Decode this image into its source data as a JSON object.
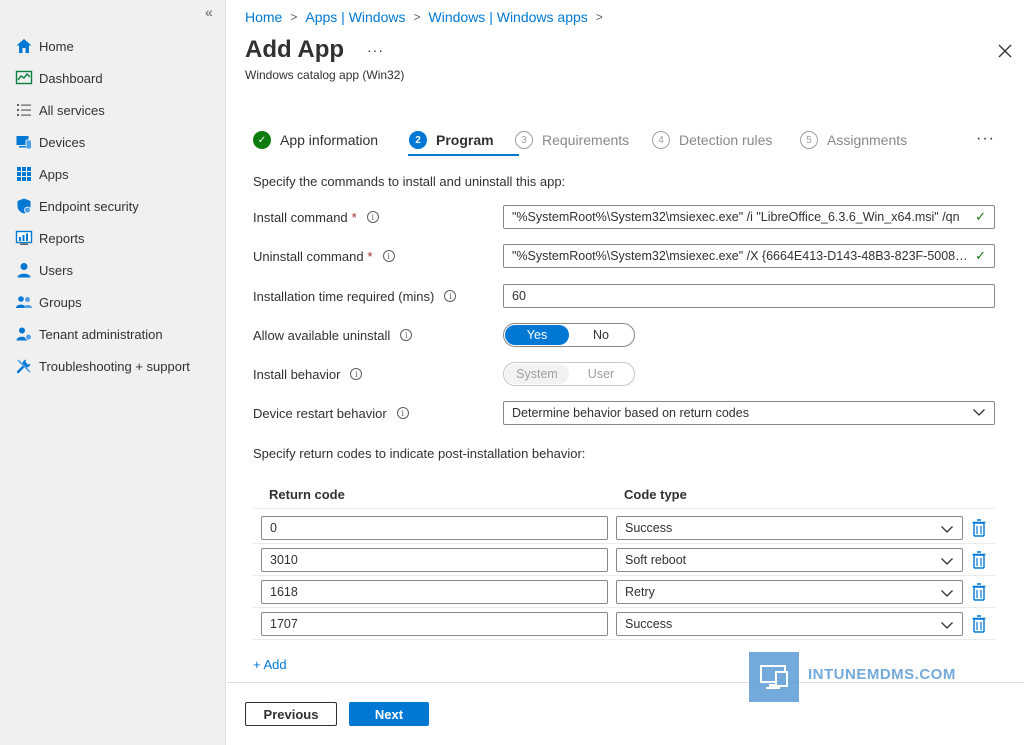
{
  "sidebar": {
    "collapse_icon": "«",
    "items": [
      {
        "label": "Home",
        "icon": "home-icon"
      },
      {
        "label": "Dashboard",
        "icon": "dashboard-icon"
      },
      {
        "label": "All services",
        "icon": "list-icon"
      },
      {
        "label": "Devices",
        "icon": "devices-icon"
      },
      {
        "label": "Apps",
        "icon": "apps-icon"
      },
      {
        "label": "Endpoint security",
        "icon": "shield-icon"
      },
      {
        "label": "Reports",
        "icon": "reports-icon"
      },
      {
        "label": "Users",
        "icon": "user-icon"
      },
      {
        "label": "Groups",
        "icon": "groups-icon"
      },
      {
        "label": "Tenant administration",
        "icon": "tenant-admin-icon"
      },
      {
        "label": "Troubleshooting + support",
        "icon": "wrench-icon"
      }
    ]
  },
  "breadcrumb": [
    "Home",
    "Apps | Windows",
    "Windows | Windows apps"
  ],
  "header": {
    "title": "Add App",
    "subtitle": "Windows catalog app (Win32)",
    "more": "···"
  },
  "steps": [
    {
      "num": "✓",
      "label": "App information",
      "state": "done"
    },
    {
      "num": "2",
      "label": "Program",
      "state": "active"
    },
    {
      "num": "3",
      "label": "Requirements",
      "state": "pending"
    },
    {
      "num": "4",
      "label": "Detection rules",
      "state": "pending"
    },
    {
      "num": "5",
      "label": "Assignments",
      "state": "pending"
    }
  ],
  "steps_more": "···",
  "form": {
    "instructions": "Specify the commands to install and uninstall this app:",
    "install_command": {
      "label": "Install command",
      "required": "*",
      "value": "\"%SystemRoot%\\System32\\msiexec.exe\" /i \"LibreOffice_6.3.6_Win_x64.msi\" /qn"
    },
    "uninstall_command": {
      "label": "Uninstall command",
      "required": "*",
      "value": "\"%SystemRoot%\\System32\\msiexec.exe\" /X {6664E413-D143-48B3-823F-50084..."
    },
    "install_time": {
      "label": "Installation time required (mins)",
      "value": "60"
    },
    "allow_uninstall": {
      "label": "Allow available uninstall",
      "options": [
        "Yes",
        "No"
      ],
      "selected": "Yes"
    },
    "install_behavior": {
      "label": "Install behavior",
      "options": [
        "System",
        "User"
      ],
      "selected": "System"
    },
    "restart_behavior": {
      "label": "Device restart behavior",
      "value": "Determine behavior based on return codes"
    },
    "return_codes_instructions": "Specify return codes to indicate post-installation behavior:"
  },
  "return_codes": {
    "headers": {
      "code": "Return code",
      "type": "Code type"
    },
    "rows": [
      {
        "code": "0",
        "type": "Success"
      },
      {
        "code": "3010",
        "type": "Soft reboot"
      },
      {
        "code": "1618",
        "type": "Retry"
      },
      {
        "code": "1707",
        "type": "Success"
      }
    ],
    "add_label": "+ Add"
  },
  "footer": {
    "previous": "Previous",
    "next": "Next"
  },
  "watermark": "INTUNEMDMS.COM",
  "colors": {
    "accent": "#0078d4",
    "success": "#107c10",
    "required": "#a4262c"
  }
}
